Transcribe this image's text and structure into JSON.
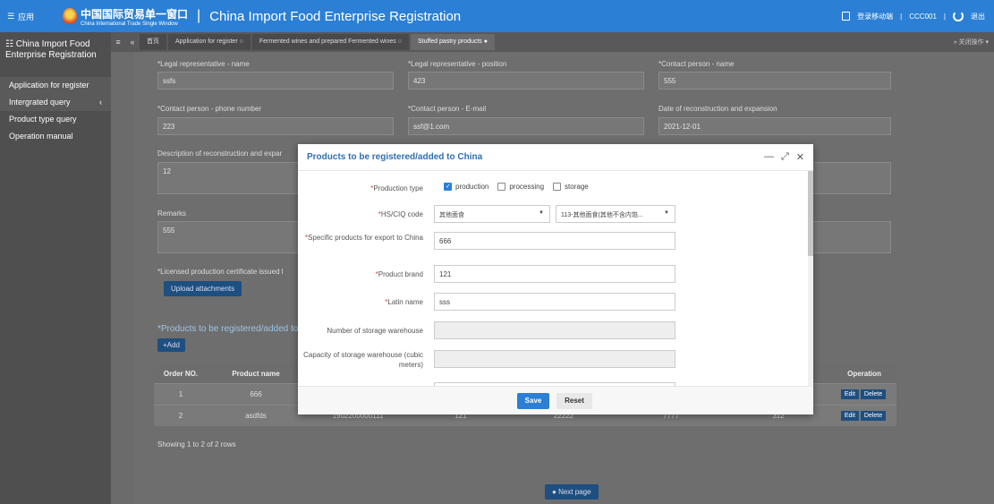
{
  "topbar": {
    "apps_label": "应用",
    "logo_cn": "中国国际贸易单一窗口",
    "logo_en": "China International Trade Single Window",
    "title": "China Import Food Enterprise Registration",
    "login_label": "登录移动端",
    "user": "CCC001",
    "logout_label": "退出"
  },
  "sidebar": {
    "header": "China Import Food Enterprise Registration",
    "items": [
      {
        "label": "Application for register"
      },
      {
        "label": "Intergrated query",
        "arrow": "‹"
      },
      {
        "label": "Product type query"
      },
      {
        "label": "Operation manual"
      }
    ]
  },
  "tabs": {
    "home": "首页",
    "items": [
      {
        "label": "Application for register"
      },
      {
        "label": "Fermented wines and prepared Fermented wines"
      },
      {
        "label": "Stuffed pastry products"
      }
    ],
    "close_ops": "关闭操作"
  },
  "form": {
    "legal_rep_name_label": "*Legal representative - name",
    "legal_rep_name": "ssfs",
    "legal_rep_pos_label": "*Legal representative - position",
    "legal_rep_pos": "423",
    "contact_name_label": "*Contact person - name",
    "contact_name": "555",
    "contact_phone_label": "*Contact person - phone number",
    "contact_phone": "223",
    "contact_email_label": "*Contact person - E-mail",
    "contact_email": "ssf@1.com",
    "date_label": "Date of reconstruction and expansion",
    "date": "2021-12-01",
    "desc_label": "Description of reconstruction and expar",
    "desc": "12",
    "remarks_label": "Remarks",
    "remarks": "555",
    "license_label": "*Licensed production certificate issued l",
    "upload_label": "Upload attachments",
    "products_label": "*Products to be registered/added to",
    "add_label": "+Add",
    "showing": "Showing 1 to 2 of 2 rows",
    "next_label": "Next page"
  },
  "table": {
    "headers": [
      "Order NO.",
      "Product name",
      "",
      "",
      "",
      "",
      "Operation"
    ],
    "rows": [
      {
        "no": "1",
        "name": "666",
        "hs": "",
        "brand": "",
        "latin": "",
        "num": "",
        "cap": ""
      },
      {
        "no": "2",
        "name": "asdfds",
        "hs": "1902200000111",
        "brand": "121",
        "latin": "22222",
        "num": "7777",
        "cap": "312"
      }
    ],
    "edit": "Edit",
    "delete": "Delete"
  },
  "modal": {
    "title": "Products to be registered/added to China",
    "production_type_label": "Production type",
    "options": [
      {
        "label": "production",
        "checked": true
      },
      {
        "label": "processing",
        "checked": false
      },
      {
        "label": "storage",
        "checked": false
      }
    ],
    "hs_label": "HS/CIQ code",
    "hs_select1": "其他面食",
    "hs_select2": "113-其他面食(其他不含内馅...",
    "specific_label": "Specific products for export to China",
    "specific_value": "666",
    "brand_label": "Product brand",
    "brand_value": "121",
    "latin_label": "Latin name",
    "latin_value": "sss",
    "storage_num_label": "Number of storage warehouse",
    "storage_num_value": "",
    "storage_cap_label": "Capacity of storage warehouse (cubic meters)",
    "storage_cap_value": "",
    "save_label": "Save",
    "reset_label": "Reset"
  }
}
